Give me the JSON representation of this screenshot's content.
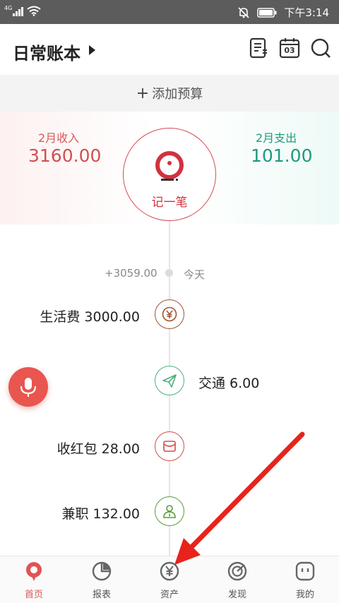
{
  "status_bar": {
    "network": "4G",
    "time": "下午3:14"
  },
  "header": {
    "title": "日常账本",
    "icons": [
      "bill-list-icon",
      "calendar-icon",
      "search-icon"
    ],
    "calendar_day": "03"
  },
  "budget": {
    "label": "添加预算"
  },
  "summary": {
    "income_label": "2月收入",
    "income_value": "3160.00",
    "expense_label": "2月支出",
    "expense_value": "101.00",
    "record_label": "记一笔"
  },
  "timeline": {
    "day_total": "+3059.00",
    "day_label": "今天",
    "entries": [
      {
        "text": "生活费 3000.00",
        "icon": "yuan-coin-icon",
        "color": "#a0522d"
      },
      {
        "text": "交通 6.00",
        "icon": "paper-plane-icon",
        "color": "#4caf7a"
      },
      {
        "text": "收红包 28.00",
        "icon": "envelope-icon",
        "color": "#d44a4a"
      },
      {
        "text": "兼职 132.00",
        "icon": "person-icon",
        "color": "#5a9a3a"
      }
    ]
  },
  "nav": {
    "items": [
      {
        "label": "首页",
        "icon": "home-location-icon",
        "active": true
      },
      {
        "label": "报表",
        "icon": "pie-chart-icon"
      },
      {
        "label": "资产",
        "icon": "yuan-asset-icon"
      },
      {
        "label": "发现",
        "icon": "target-icon"
      },
      {
        "label": "我的",
        "icon": "profile-face-icon"
      }
    ]
  },
  "colors": {
    "accent": "#e25353",
    "income": "#d05050",
    "expense": "#1f9a7e",
    "arrow": "#e8231b"
  }
}
